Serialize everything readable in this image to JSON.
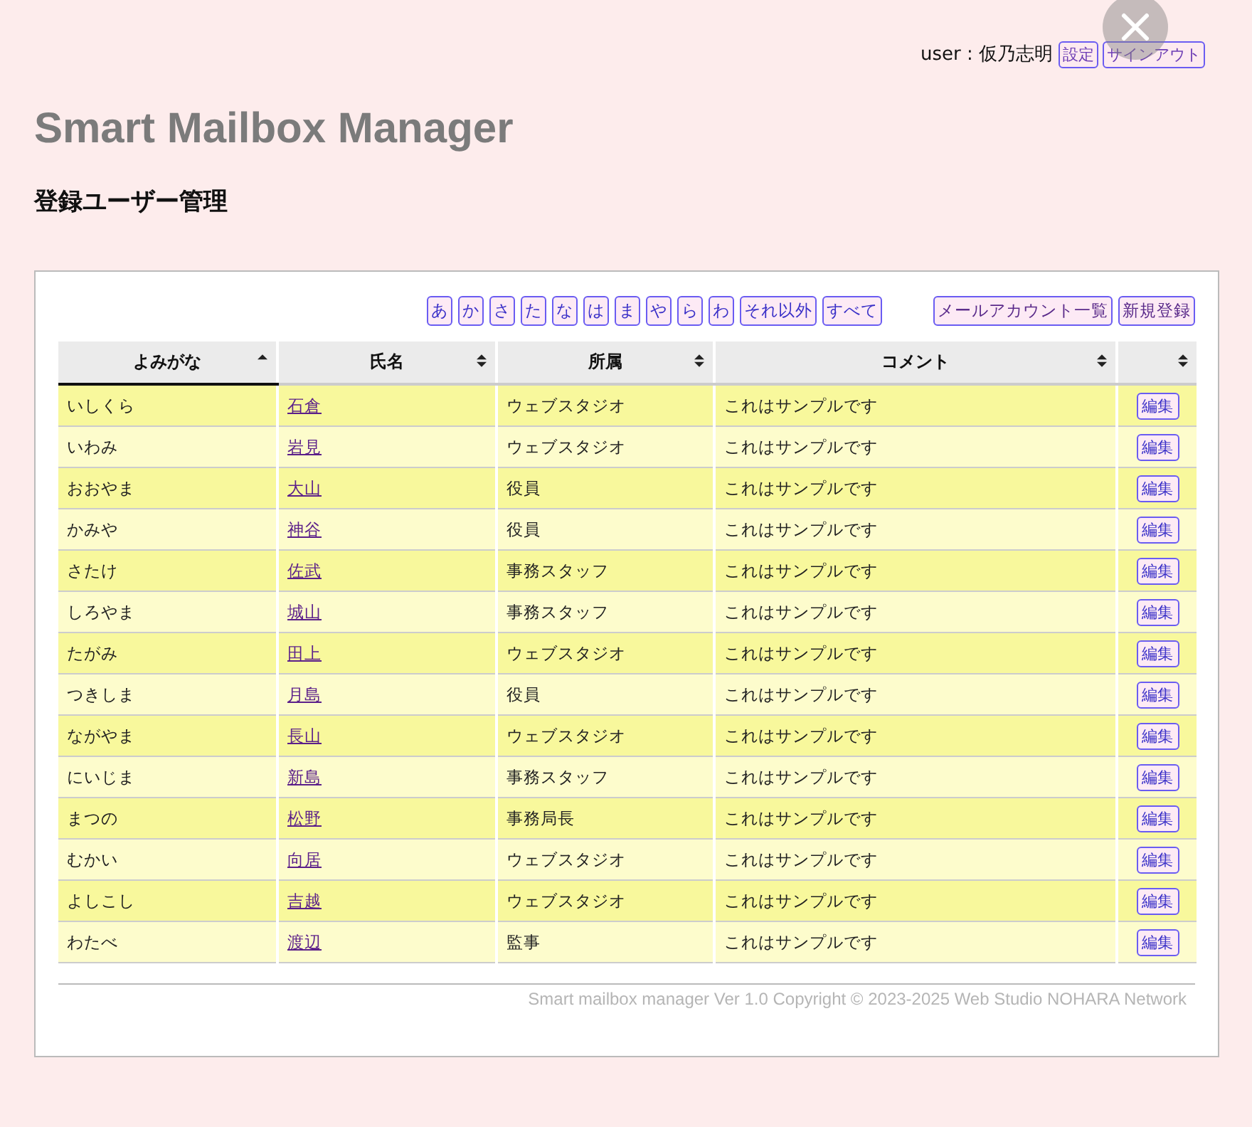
{
  "header": {
    "user_label": "user : 仮乃志明",
    "buttons": [
      "設定",
      "サインアウト"
    ]
  },
  "title": "Smart Mailbox Manager",
  "subtitle": "登録ユーザー管理",
  "filters": [
    "あ",
    "か",
    "さ",
    "た",
    "な",
    "は",
    "ま",
    "や",
    "ら",
    "わ",
    "それ以外",
    "すべて"
  ],
  "actions": [
    "メールアカウント一覧",
    "新規登録"
  ],
  "table": {
    "columns": [
      {
        "label": "よみがな",
        "sorted": true
      },
      {
        "label": "氏名",
        "sorted": false
      },
      {
        "label": "所属",
        "sorted": false
      },
      {
        "label": "コメント",
        "sorted": false
      },
      {
        "sorted": false
      }
    ],
    "rows": [
      {
        "kana": "いしくら",
        "name": "石倉",
        "dept": "ウェブスタジオ",
        "comment": "これはサンプルです",
        "action": "編集"
      },
      {
        "kana": "いわみ",
        "name": "岩見",
        "dept": "ウェブスタジオ",
        "comment": "これはサンプルです",
        "action": "編集"
      },
      {
        "kana": "おおやま",
        "name": "大山",
        "dept": "役員",
        "comment": "これはサンプルです",
        "action": "編集"
      },
      {
        "kana": "かみや",
        "name": "神谷",
        "dept": "役員",
        "comment": "これはサンプルです",
        "action": "編集"
      },
      {
        "kana": "さたけ",
        "name": "佐武",
        "dept": "事務スタッフ",
        "comment": "これはサンプルです",
        "action": "編集"
      },
      {
        "kana": "しろやま",
        "name": "城山",
        "dept": "事務スタッフ",
        "comment": "これはサンプルです",
        "action": "編集"
      },
      {
        "kana": "たがみ",
        "name": "田上",
        "dept": "ウェブスタジオ",
        "comment": "これはサンプルです",
        "action": "編集"
      },
      {
        "kana": "つきしま",
        "name": "月島",
        "dept": "役員",
        "comment": "これはサンプルです",
        "action": "編集"
      },
      {
        "kana": "ながやま",
        "name": "長山",
        "dept": "ウェブスタジオ",
        "comment": "これはサンプルです",
        "action": "編集"
      },
      {
        "kana": "にいじま",
        "name": "新島",
        "dept": "事務スタッフ",
        "comment": "これはサンプルです",
        "action": "編集"
      },
      {
        "kana": "まつの",
        "name": "松野",
        "dept": "事務局長",
        "comment": "これはサンプルです",
        "action": "編集"
      },
      {
        "kana": "むかい",
        "name": "向居",
        "dept": "ウェブスタジオ",
        "comment": "これはサンプルです",
        "action": "編集"
      },
      {
        "kana": "よしこし",
        "name": "吉越",
        "dept": "ウェブスタジオ",
        "comment": "これはサンプルです",
        "action": "編集"
      },
      {
        "kana": "わたべ",
        "name": "渡辺",
        "dept": "監事",
        "comment": "これはサンプルです",
        "action": "編集"
      }
    ]
  },
  "footer": "Smart mailbox manager Ver 1.0 Copyright © 2023-2025 Web Studio NOHARA Network"
}
